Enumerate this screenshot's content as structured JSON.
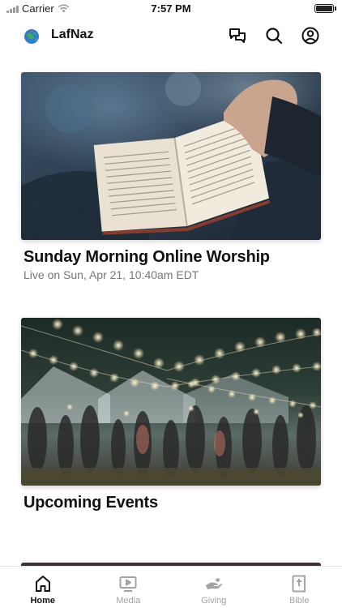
{
  "status_bar": {
    "carrier": "Carrier",
    "time": "7:57 PM",
    "battery_level": 1.0
  },
  "header": {
    "title": "LafNaz",
    "logo_icon": "globe-logo-icon",
    "icons": [
      "chat-icon",
      "search-icon",
      "profile-icon"
    ]
  },
  "feed": {
    "cards": [
      {
        "title": "Sunday Morning Online Worship",
        "subtitle": "Live on Sun, Apr 21, 10:40am EDT",
        "image": "open-bible-photo"
      },
      {
        "title": "Upcoming Events",
        "subtitle": "",
        "image": "string-lights-event-photo"
      }
    ]
  },
  "tab_bar": {
    "active": "Home",
    "tabs": [
      {
        "label": "Home",
        "icon": "home-icon"
      },
      {
        "label": "Media",
        "icon": "media-icon"
      },
      {
        "label": "Giving",
        "icon": "giving-icon"
      },
      {
        "label": "Bible",
        "icon": "bible-icon"
      }
    ]
  },
  "colors": {
    "text": "#111111",
    "muted": "#777777",
    "tab_inactive": "#a3a3a3"
  }
}
